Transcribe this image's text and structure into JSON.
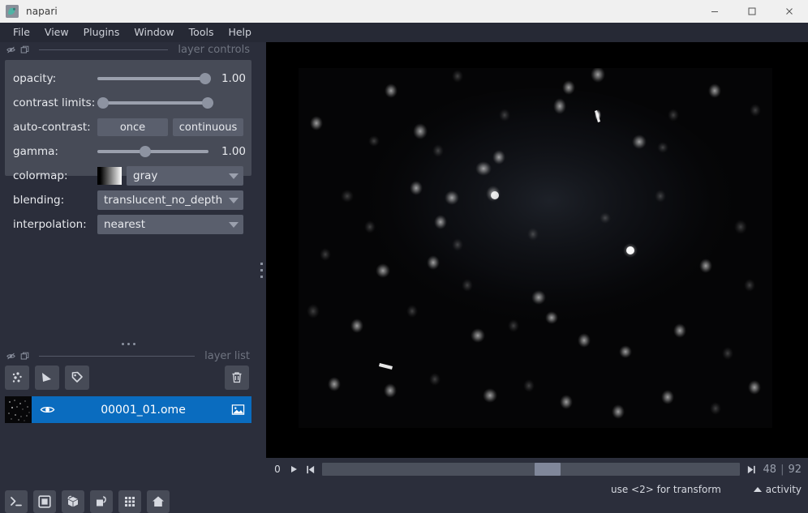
{
  "window": {
    "title": "napari",
    "app_icon": "napari-logo-icon",
    "controls": [
      {
        "name": "minimize-button",
        "icon": "minimize-icon"
      },
      {
        "name": "maximize-button",
        "icon": "maximize-icon"
      },
      {
        "name": "close-button",
        "icon": "close-icon"
      }
    ]
  },
  "menubar": {
    "items": [
      {
        "label": "File"
      },
      {
        "label": "View"
      },
      {
        "label": "Plugins"
      },
      {
        "label": "Window"
      },
      {
        "label": "Tools"
      },
      {
        "label": "Help"
      }
    ]
  },
  "layer_controls": {
    "dock_title": "layer controls",
    "dock_icons": [
      "hide-icon",
      "float-icon"
    ],
    "rows": {
      "opacity": {
        "label": "opacity:",
        "value": "1.00",
        "knob_pct": 97
      },
      "contrast_limits": {
        "label": "contrast limits:",
        "low_pct": 0,
        "high_pct": 100
      },
      "auto_contrast": {
        "label": "auto-contrast:",
        "once_label": "once",
        "continuous_label": "continuous"
      },
      "gamma": {
        "label": "gamma:",
        "value": "1.00",
        "knob_pct": 43
      },
      "colormap": {
        "label": "colormap:",
        "value": "gray"
      },
      "blending": {
        "label": "blending:",
        "value": "translucent_no_depth"
      },
      "interpolation": {
        "label": "interpolation:",
        "value": "nearest"
      }
    }
  },
  "layer_list": {
    "dock_title": "layer list",
    "dock_icons": [
      "hide-icon",
      "float-icon"
    ],
    "buttons": [
      {
        "name": "new-points-layer-button",
        "icon": "points-icon"
      },
      {
        "name": "new-shapes-layer-button",
        "icon": "shapes-icon"
      },
      {
        "name": "new-labels-layer-button",
        "icon": "labels-icon"
      },
      {
        "name": "delete-layer-button",
        "icon": "trash-icon"
      }
    ],
    "layers": [
      {
        "name": "00001_01.ome",
        "visible": true,
        "selected": true,
        "type_icon": "image-layer-icon",
        "visibility_icon": "eye-icon"
      }
    ]
  },
  "viewer_buttons": [
    {
      "name": "console-button",
      "icon": "terminal-icon"
    },
    {
      "name": "ndisplay-2d-button",
      "icon": "square-icon"
    },
    {
      "name": "ndisplay-3d-button",
      "icon": "cube-icon"
    },
    {
      "name": "roll-dimensions-button",
      "icon": "roll-icon"
    },
    {
      "name": "transpose-dimensions-button",
      "icon": "grid-icon"
    },
    {
      "name": "reset-view-button",
      "icon": "home-icon"
    }
  ],
  "dims": {
    "axis_label": "0",
    "play_icon": "play-icon",
    "step_icon": "step-left-icon",
    "end_icon": "step-right-icon",
    "current": "48",
    "separator": "|",
    "max": "92",
    "thumb_pct": 51
  },
  "statusbar": {
    "hint": "use <2> for transform",
    "activity_label": "activity",
    "activity_icon": "caret-up-icon"
  },
  "canvas": {
    "name": "image-canvas",
    "description": "fluorescence-microscopy-nuclei",
    "background": "#000000",
    "image_background": "#050506"
  },
  "colors": {
    "titlebar_bg": "#f0f0f0",
    "menubar_bg": "#262935",
    "window_bg": "#2b2e3b",
    "panel_bg": "#474b57",
    "widget_bg": "#5a5f6d",
    "accent_selected": "#0a6cbf",
    "text_primary": "#e8eaee",
    "text_muted": "#6f7480",
    "slider_track": "#9ba0ad",
    "slider_knob": "#8d93a1"
  }
}
